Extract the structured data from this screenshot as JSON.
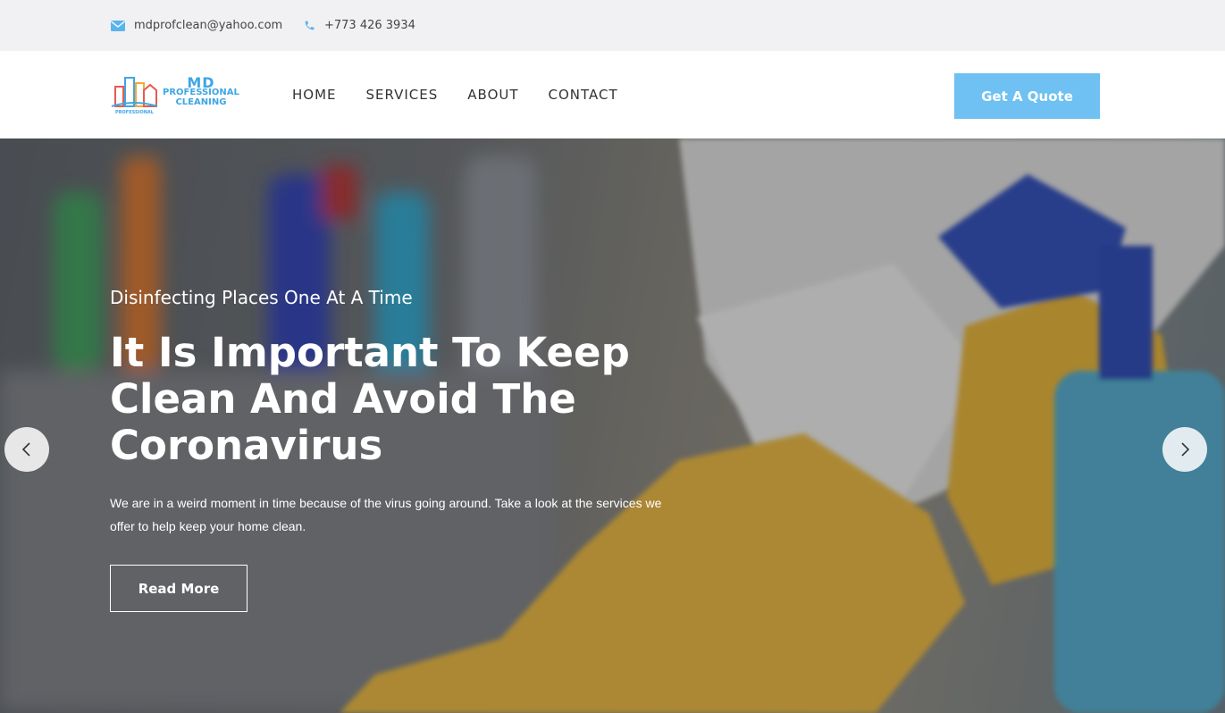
{
  "topbar": {
    "email": "mdprofclean@yahoo.com",
    "phone": "+773 426 3934",
    "email_icon": "envelope-icon",
    "phone_icon": "phone-icon"
  },
  "header": {
    "logo_text_main": "MD",
    "logo_text_line1": "PROFESSIONAL",
    "logo_text_line2": "CLEANING",
    "nav": [
      "HOME",
      "SERVICES",
      "ABOUT",
      "CONTACT"
    ],
    "cta_label": "Get A Quote"
  },
  "hero": {
    "subtitle": "Disinfecting Places One At A Time",
    "title": "It Is Important To Keep Clean And Avoid The Coronavirus",
    "description": "We are in a weird moment in time because of the virus going around. Take a look at the services we offer to help keep your home clean.",
    "button_label": "Read More"
  },
  "colors": {
    "accent": "#6ec1f2",
    "topbar_bg": "#f1f1f3",
    "icon": "#5ab4ec"
  }
}
